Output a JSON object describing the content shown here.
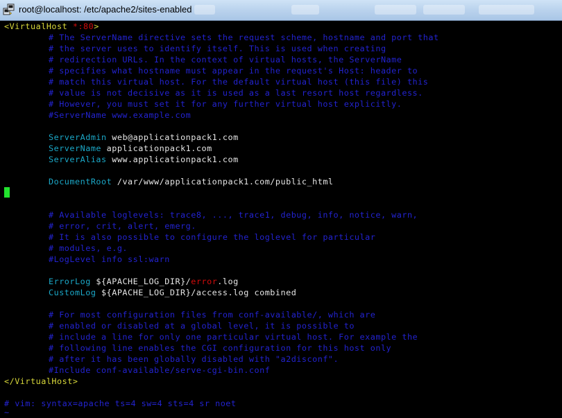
{
  "window": {
    "title": "root@localhost: /etc/apache2/sites-enabled"
  },
  "terminal": {
    "vh_open_tag": "<VirtualHost",
    "vh_open_port": " *:80",
    "vh_open_close": ">",
    "comment_servername": [
      "# The ServerName directive sets the request scheme, hostname and port that",
      "# the server uses to identify itself. This is used when creating",
      "# redirection URLs. In the context of virtual hosts, the ServerName",
      "# specifies what hostname must appear in the request's Host: header to",
      "# match this virtual host. For the default virtual host (this file) this",
      "# value is not decisive as it is used as a last resort host regardless.",
      "# However, you must set it for any further virtual host explicitly.",
      "#ServerName www.example.com"
    ],
    "server_admin_key": "ServerAdmin",
    "server_admin_val": " web@applicationpack1.com",
    "server_name_key": "ServerName",
    "server_name_val": " applicationpack1.com",
    "server_alias_key": "ServerAlias",
    "server_alias_val": " www.applicationpack1.com",
    "document_root_key": "DocumentRoot",
    "document_root_val": " /var/www/applicationpack1.com/public_html",
    "comment_loglevel": [
      "# Available loglevels: trace8, ..., trace1, debug, info, notice, warn,",
      "# error, crit, alert, emerg.",
      "# It is also possible to configure the loglevel for particular",
      "# modules, e.g.",
      "#LogLevel info ssl:warn"
    ],
    "error_log_key": "ErrorLog",
    "error_log_val_a": " ${APACHE_LOG_DIR}/",
    "error_log_val_b": "error",
    "error_log_val_c": ".log",
    "custom_log_key": "CustomLog",
    "custom_log_val": " ${APACHE_LOG_DIR}/access.log combined",
    "comment_conf": [
      "# For most configuration files from conf-available/, which are",
      "# enabled or disabled at a global level, it is possible to",
      "# include a line for only one particular virtual host. For example the",
      "# following line enables the CGI configuration for this host only",
      "# after it has been globally disabled with \"a2disconf\".",
      "#Include conf-available/serve-cgi-bin.conf"
    ],
    "vh_close": "</VirtualHost>",
    "modeline": "# vim: syntax=apache ts=4 sw=4 sts=4 sr noet",
    "tilde": "~"
  },
  "colors": {
    "background": "#000000",
    "keyword": "#1ba8c8",
    "comment": "#2323d0",
    "tag": "#d8d83a",
    "cursor": "#22e22e"
  }
}
